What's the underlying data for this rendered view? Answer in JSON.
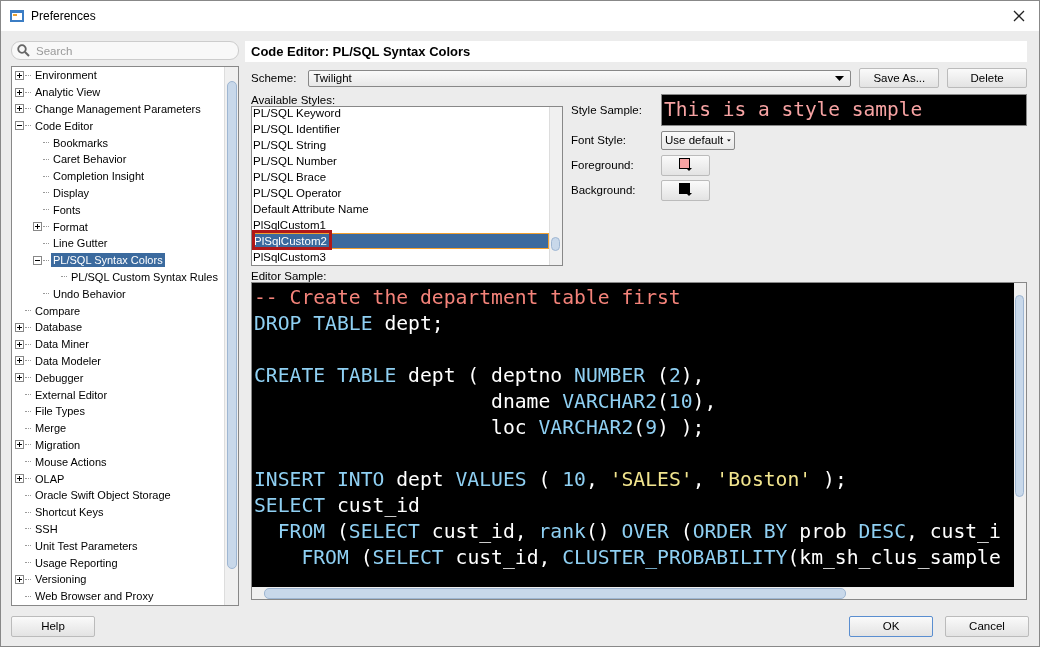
{
  "window": {
    "title": "Preferences"
  },
  "search": {
    "placeholder": "Search"
  },
  "tree": {
    "items": [
      {
        "label": "Environment",
        "expanded": false,
        "selected": false
      },
      {
        "label": "Analytic View",
        "expanded": false,
        "selected": false
      },
      {
        "label": "Change Management Parameters",
        "expanded": false,
        "selected": false
      },
      {
        "label": "Code Editor",
        "expanded": true,
        "selected": false,
        "children": [
          {
            "label": "Bookmarks",
            "selected": false
          },
          {
            "label": "Caret Behavior",
            "selected": false
          },
          {
            "label": "Completion Insight",
            "selected": false
          },
          {
            "label": "Display",
            "selected": false
          },
          {
            "label": "Fonts",
            "selected": false
          },
          {
            "label": "Format",
            "expanded": false,
            "selected": false
          },
          {
            "label": "Line Gutter",
            "selected": false
          },
          {
            "label": "PL/SQL Syntax Colors",
            "expanded": true,
            "selected": true,
            "children": [
              {
                "label": "PL/SQL Custom Syntax Rules",
                "selected": false
              }
            ]
          },
          {
            "label": "Undo Behavior",
            "selected": false
          }
        ]
      },
      {
        "label": "Compare",
        "selected": false
      },
      {
        "label": "Database",
        "expanded": false,
        "selected": false
      },
      {
        "label": "Data Miner",
        "expanded": false,
        "selected": false
      },
      {
        "label": "Data Modeler",
        "expanded": false,
        "selected": false
      },
      {
        "label": "Debugger",
        "expanded": false,
        "selected": false
      },
      {
        "label": "External Editor",
        "selected": false
      },
      {
        "label": "File Types",
        "selected": false
      },
      {
        "label": "Merge",
        "selected": false
      },
      {
        "label": "Migration",
        "expanded": false,
        "selected": false
      },
      {
        "label": "Mouse Actions",
        "selected": false
      },
      {
        "label": "OLAP",
        "expanded": false,
        "selected": false
      },
      {
        "label": "Oracle Swift Object Storage",
        "selected": false
      },
      {
        "label": "Shortcut Keys",
        "selected": false
      },
      {
        "label": "SSH",
        "selected": false
      },
      {
        "label": "Unit Test Parameters",
        "selected": false
      },
      {
        "label": "Usage Reporting",
        "selected": false
      },
      {
        "label": "Versioning",
        "expanded": false,
        "selected": false
      },
      {
        "label": "Web Browser and Proxy",
        "selected": false
      }
    ]
  },
  "page_title": "Code Editor: PL/SQL Syntax Colors",
  "scheme": {
    "label": "Scheme:",
    "value": "Twilight"
  },
  "scheme_buttons": [
    "Save As...",
    "Delete"
  ],
  "styles": {
    "label": "Available Styles:",
    "items": [
      {
        "label": "PL/SQL Keyword",
        "selected": false,
        "highlighted": false
      },
      {
        "label": "PL/SQL Identifier",
        "selected": false,
        "highlighted": false
      },
      {
        "label": "PL/SQL String",
        "selected": false,
        "highlighted": false
      },
      {
        "label": "PL/SQL Number",
        "selected": false,
        "highlighted": false
      },
      {
        "label": "PL/SQL Brace",
        "selected": false,
        "highlighted": false
      },
      {
        "label": "PL/SQL Operator",
        "selected": false,
        "highlighted": false
      },
      {
        "label": "Default Attribute Name",
        "selected": false,
        "highlighted": false
      },
      {
        "label": "PlSqlCustom1",
        "selected": false,
        "highlighted": false
      },
      {
        "label": "PlSqlCustom2",
        "selected": true,
        "highlighted": true
      },
      {
        "label": "PlSqlCustom3",
        "selected": false,
        "highlighted": false
      }
    ]
  },
  "style_sample": {
    "label": "Style Sample:",
    "text": "This is a style sample"
  },
  "font_style": {
    "label": "Font Style:",
    "value": "Use default"
  },
  "foreground": {
    "label": "Foreground:",
    "color": "#f7a3a3"
  },
  "background": {
    "label": "Background:",
    "color": "#000000"
  },
  "editor_sample": {
    "label": "Editor Sample:",
    "lines": [
      {
        "kind": "plain",
        "tokens": [
          {
            "kind": "comment",
            "text": "-- Create the department table first"
          }
        ]
      },
      {
        "kind": "plain",
        "tokens": [
          {
            "kind": "keyword",
            "text": "DROP TABLE"
          },
          {
            "kind": "plain",
            "text": " dept;"
          }
        ]
      },
      {
        "kind": "blank"
      },
      {
        "kind": "plain",
        "tokens": [
          {
            "kind": "keyword",
            "text": "CREATE TABLE"
          },
          {
            "kind": "plain",
            "text": " dept ( deptno "
          },
          {
            "kind": "keyword",
            "text": "NUMBER"
          },
          {
            "kind": "plain",
            "text": " ("
          },
          {
            "kind": "number",
            "text": "2"
          },
          {
            "kind": "plain",
            "text": "),"
          }
        ]
      },
      {
        "kind": "indent20",
        "tokens": [
          {
            "kind": "plain",
            "text": "dname "
          },
          {
            "kind": "keyword",
            "text": "VARCHAR2"
          },
          {
            "kind": "plain",
            "text": "("
          },
          {
            "kind": "number",
            "text": "10"
          },
          {
            "kind": "plain",
            "text": "),"
          }
        ]
      },
      {
        "kind": "indent20",
        "tokens": [
          {
            "kind": "plain",
            "text": "loc "
          },
          {
            "kind": "keyword",
            "text": "VARCHAR2"
          },
          {
            "kind": "plain",
            "text": "("
          },
          {
            "kind": "number",
            "text": "9"
          },
          {
            "kind": "plain",
            "text": ") );"
          }
        ]
      },
      {
        "kind": "blank"
      },
      {
        "kind": "plain",
        "tokens": [
          {
            "kind": "keyword",
            "text": "INSERT INTO"
          },
          {
            "kind": "plain",
            "text": " dept "
          },
          {
            "kind": "keyword",
            "text": "VALUES"
          },
          {
            "kind": "plain",
            "text": " ( "
          },
          {
            "kind": "number",
            "text": "10"
          },
          {
            "kind": "plain",
            "text": ", "
          },
          {
            "kind": "string",
            "text": "'SALES'"
          },
          {
            "kind": "plain",
            "text": ", "
          },
          {
            "kind": "string",
            "text": "'Boston'"
          },
          {
            "kind": "plain",
            "text": " );"
          }
        ]
      },
      {
        "kind": "plain",
        "tokens": [
          {
            "kind": "keyword",
            "text": "SELECT"
          },
          {
            "kind": "plain",
            "text": " cust_id"
          }
        ]
      },
      {
        "kind": "indent2",
        "tokens": [
          {
            "kind": "keyword",
            "text": "FROM"
          },
          {
            "kind": "plain",
            "text": " ("
          },
          {
            "kind": "keyword",
            "text": "SELECT"
          },
          {
            "kind": "plain",
            "text": " cust_id, "
          },
          {
            "kind": "keyword",
            "text": "rank"
          },
          {
            "kind": "plain",
            "text": "() "
          },
          {
            "kind": "keyword",
            "text": "OVER"
          },
          {
            "kind": "plain",
            "text": " ("
          },
          {
            "kind": "keyword",
            "text": "ORDER BY"
          },
          {
            "kind": "plain",
            "text": " prob "
          },
          {
            "kind": "keyword",
            "text": "DESC"
          },
          {
            "kind": "plain",
            "text": ", cust_i"
          }
        ]
      },
      {
        "kind": "indent4",
        "tokens": [
          {
            "kind": "keyword",
            "text": "FROM"
          },
          {
            "kind": "plain",
            "text": " ("
          },
          {
            "kind": "keyword",
            "text": "SELECT"
          },
          {
            "kind": "plain",
            "text": " cust_id, "
          },
          {
            "kind": "keyword",
            "text": "CLUSTER_PROBABILITY"
          },
          {
            "kind": "plain",
            "text": "(km_sh_clus_sample"
          }
        ]
      }
    ]
  },
  "footer": {
    "help": "Help",
    "buttons": [
      "OK",
      "Cancel"
    ]
  }
}
